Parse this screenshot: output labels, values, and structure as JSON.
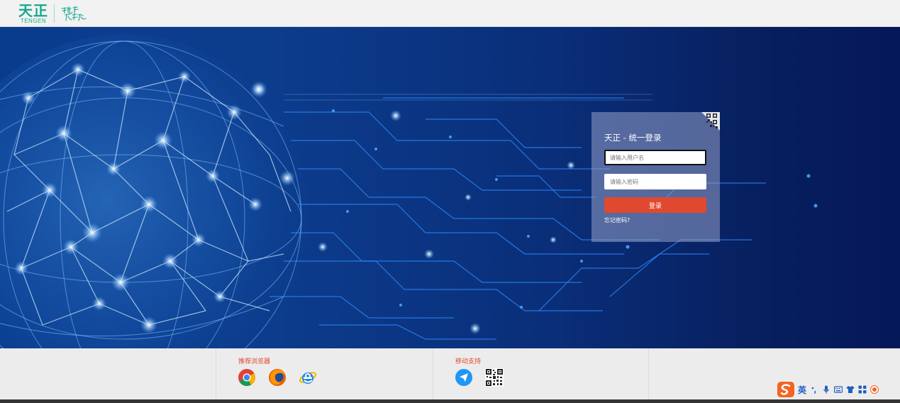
{
  "header": {
    "logo_cn": "天正",
    "logo_en": "TENGEN"
  },
  "login": {
    "title": "天正 - 统一登录",
    "username_placeholder": "请输入用户名",
    "password_placeholder": "请输入密码",
    "submit_label": "登录",
    "forgot_label": "忘记密码?"
  },
  "footer": {
    "browsers_title": "推荐浏览器",
    "browsers": [
      "chrome-icon",
      "firefox-icon",
      "ie-icon"
    ],
    "mobile_title": "移动支持",
    "mobile": [
      "mobile-app-icon",
      "qr-code-icon"
    ]
  },
  "ime": {
    "mode_label": "英"
  },
  "colors": {
    "brand_green": "#17a88e",
    "accent_red": "#e0492f",
    "banner_blue": "#0a3c8e"
  }
}
